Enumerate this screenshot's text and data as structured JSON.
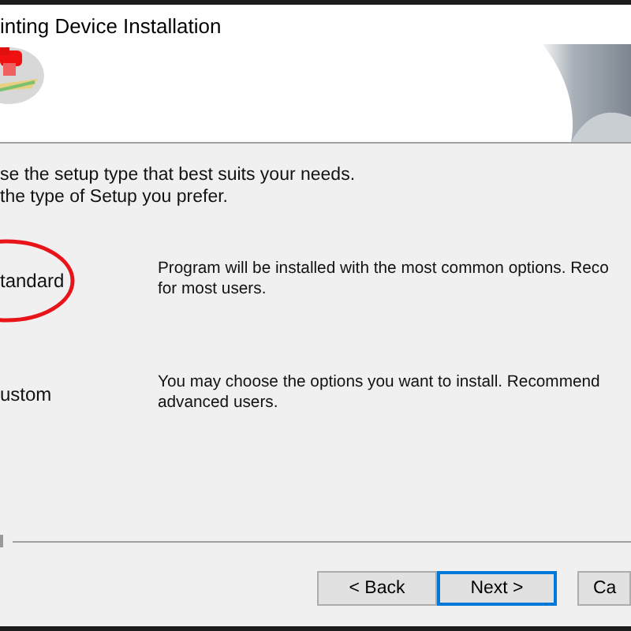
{
  "window": {
    "title": "inting Device Installation"
  },
  "instructions": [
    "se the setup type that best suits your needs.",
    "the type of Setup you prefer."
  ],
  "options": [
    {
      "label": "tandard",
      "description": [
        "Program will be installed with the most common options. Reco",
        "for most users."
      ],
      "circled": true
    },
    {
      "label": "ustom",
      "description": [
        "You may choose the options you want to install. Recommend",
        "advanced users."
      ],
      "circled": false
    }
  ],
  "buttons": [
    {
      "label": "< Back",
      "focused": false
    },
    {
      "label": "Next >",
      "focused": true
    },
    {
      "label": "Ca",
      "focused": false
    }
  ]
}
